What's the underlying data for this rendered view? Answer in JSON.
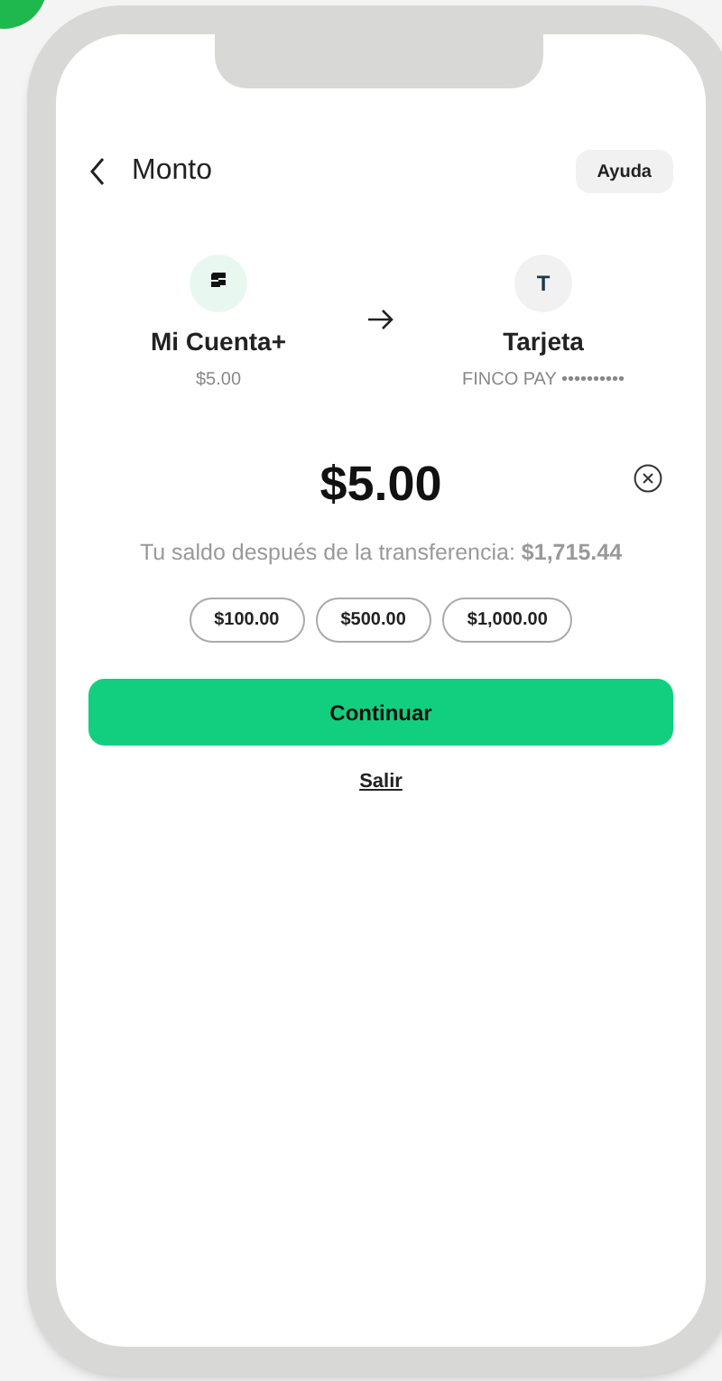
{
  "header": {
    "title": "Monto",
    "help_button": "Ayuda"
  },
  "transfer": {
    "from": {
      "name": "Mi Cuenta+",
      "detail": "$5.00"
    },
    "to": {
      "initial": "T",
      "name": "Tarjeta",
      "detail": "FINCO PAY ••••••••••"
    }
  },
  "amount": "$5.00",
  "balance": "Tu saldo después de la transferencia: **$1,715.44**",
  "presets": [
    "$100.00",
    "$500.00",
    "$1,000.00"
  ],
  "primary_button": "Continuar",
  "exit_link": "Salir"
}
